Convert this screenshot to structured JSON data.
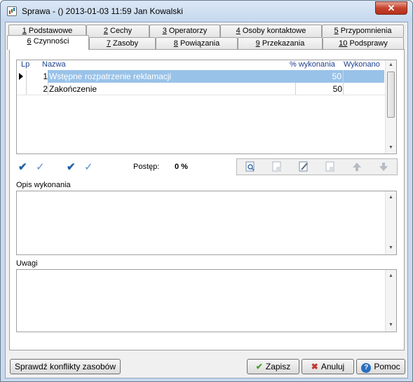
{
  "window": {
    "title": "Sprawa - ()  2013-01-03 11:59  Jan Kowalski",
    "close_label": "✕"
  },
  "tabs_row1": [
    {
      "num": "1",
      "label": "Podstawowe"
    },
    {
      "num": "2",
      "label": "Cechy"
    },
    {
      "num": "3",
      "label": "Operatorzy"
    },
    {
      "num": "4",
      "label": "Osoby kontaktowe"
    },
    {
      "num": "5",
      "label": "Przypomnienia"
    }
  ],
  "tabs_row2": [
    {
      "num": "6",
      "label": "Czynności",
      "active": true
    },
    {
      "num": "7",
      "label": "Zasoby"
    },
    {
      "num": "8",
      "label": "Powiązania"
    },
    {
      "num": "9",
      "label": "Przekazania"
    },
    {
      "num": "10",
      "label": "Podsprawy"
    }
  ],
  "grid": {
    "columns": {
      "lp": "Lp",
      "nazwa": "Nazwa",
      "procent": "% wykonania",
      "wykonano": "Wykonano"
    },
    "rows": [
      {
        "lp": "1",
        "nazwa": "Wstępne rozpatrzenie reklamacji",
        "procent": "50",
        "wykonano": ""
      },
      {
        "lp": "2",
        "nazwa": "Zakończenie",
        "procent": "50",
        "wykonano": ""
      }
    ]
  },
  "progress": {
    "label": "Postęp:",
    "value": "0 %"
  },
  "opis_label": "Opis wykonania",
  "uwagi_label": "Uwagi",
  "buttons": {
    "conflicts": "Sprawdź konflikty zasobów",
    "save": "Zapisz",
    "cancel": "Anuluj",
    "help": "Pomoc"
  },
  "colors": {
    "selection": "#99c2e8",
    "save_icon": "#4aa02c",
    "cancel_icon": "#c0392b",
    "help_icon": "#2a6ebf"
  }
}
